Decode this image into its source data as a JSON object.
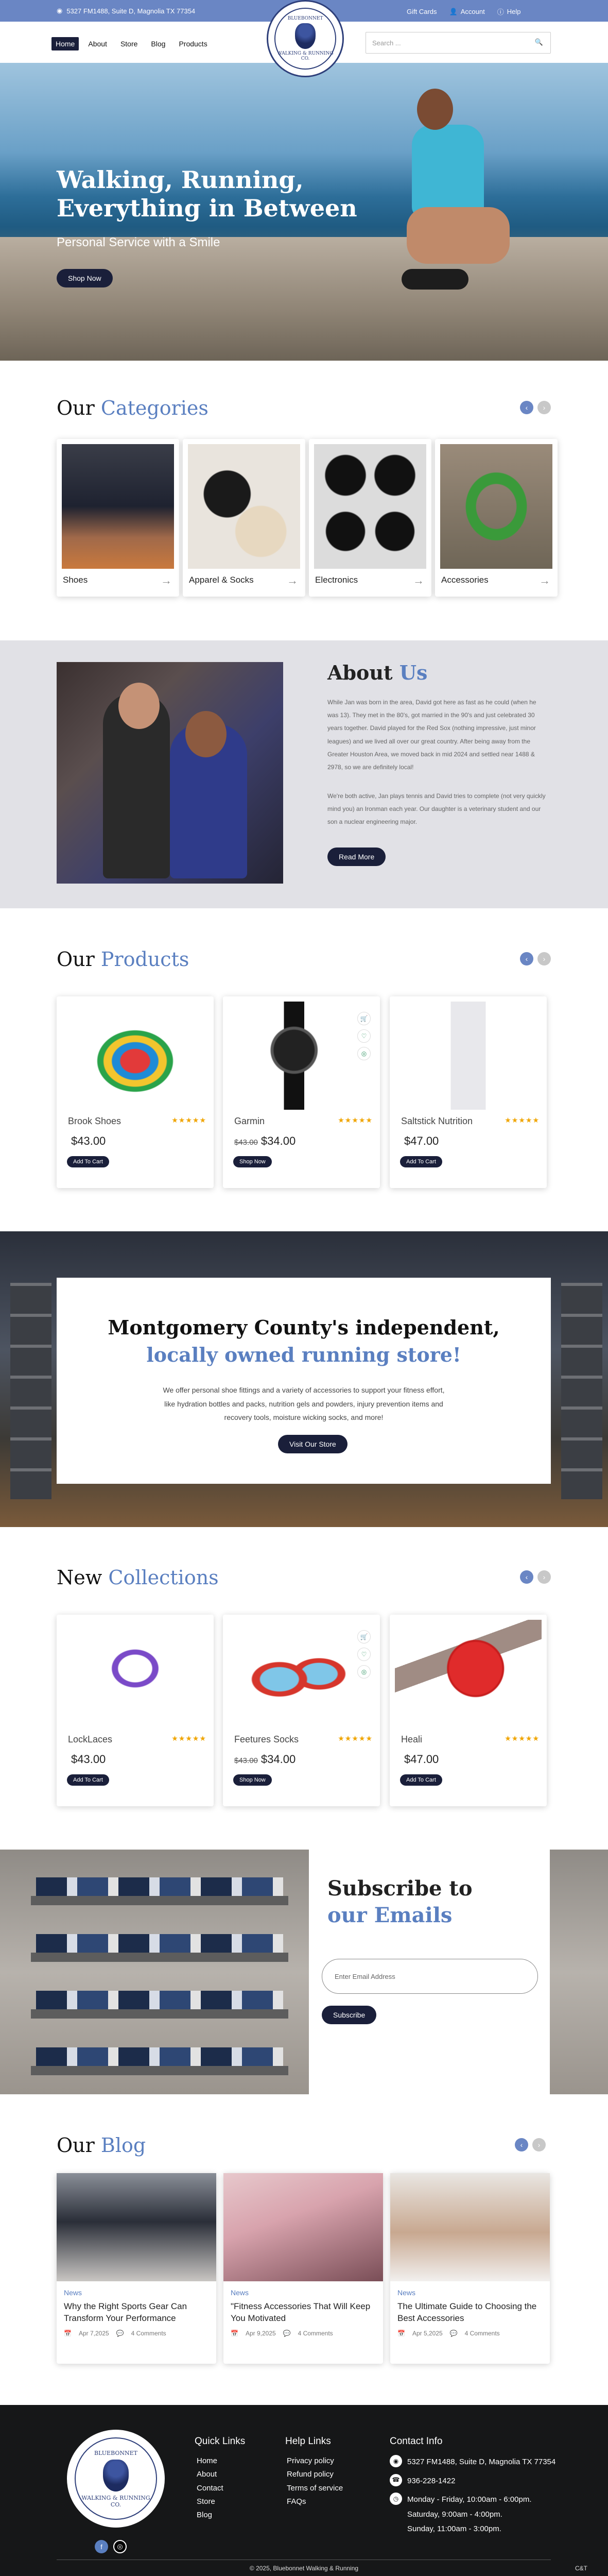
{
  "topbar": {
    "address": "5327 FM1488, Suite D, Magnolia TX 77354",
    "gift_cards": "Gift Cards",
    "account": "Account",
    "help": "Help"
  },
  "nav": {
    "items": [
      "Home",
      "About",
      "Store",
      "Blog",
      "Products"
    ],
    "active": "Home",
    "search_placeholder": "Search ..."
  },
  "logo": {
    "line1": "BLUEBONNET",
    "line2": "WALKING & RUNNING CO."
  },
  "hero": {
    "title_line1": "Walking, Running,",
    "title_line2": "Everything in Between",
    "subtitle": "Personal Service with a Smile",
    "cta": "Shop Now"
  },
  "categories": {
    "heading_plain": "Our",
    "heading_accent": "Categories",
    "items": [
      {
        "label": "Shoes"
      },
      {
        "label": "Apparel & Socks"
      },
      {
        "label": "Electronics"
      },
      {
        "label": "Accessories"
      }
    ]
  },
  "about": {
    "heading_plain": "About",
    "heading_accent": "Us",
    "para1": "While Jan was born in the area, David got here as fast as he could (when he was 13). They met in the 80's, got married in the 90's and just celebrated 30 years together. David played for the Red Sox (nothing impressive, just minor leagues) and we lived all over our great country. After being away from the Greater Houston Area, we moved back in mid 2024 and settled near 1488 & 2978, so we are definitely local!",
    "para2": "We're both active, Jan plays tennis and David tries to complete (not very quickly mind you) an Ironman each year. Our daughter is a veterinary student and our son a nuclear engineering major.",
    "cta": "Read More"
  },
  "products": {
    "heading_plain": "Our",
    "heading_accent": "Products",
    "items": [
      {
        "name": "Brook Shoes",
        "old_price": "",
        "price": "$43.00",
        "button": "Add To Cart",
        "stars": "★★★★★"
      },
      {
        "name": "Garmin",
        "old_price": "$43.00",
        "price": "$34.00",
        "button": "Shop Now",
        "stars": "★★★★★"
      },
      {
        "name": "Saltstick Nutrition",
        "old_price": "",
        "price": "$47.00",
        "button": "Add To Cart",
        "stars": "★★★★★"
      }
    ]
  },
  "store_banner": {
    "title_line1": "Montgomery County's independent,",
    "title_line2": "locally owned running store!",
    "text": "We offer personal shoe fittings and a variety of accessories to support your fitness effort, like hydration bottles and packs, nutrition gels and powders, injury prevention items and recovery tools, moisture wicking socks, and more!",
    "cta": "Visit Our Store"
  },
  "collections": {
    "heading_plain": "New",
    "heading_accent": "Collections",
    "items": [
      {
        "name": "LockLaces",
        "old_price": "",
        "price": "$43.00",
        "button": "Add To Cart",
        "stars": "★★★★★"
      },
      {
        "name": "Feetures Socks",
        "old_price": "$43.00",
        "price": "$34.00",
        "button": "Shop Now",
        "stars": "★★★★★"
      },
      {
        "name": "Heali",
        "old_price": "",
        "price": "$47.00",
        "button": "Add To Cart",
        "stars": "★★★★★"
      }
    ]
  },
  "subscribe": {
    "title_line1": "Subscribe to",
    "title_line2": "our Emails",
    "placeholder": "Enter Email Address",
    "cta": "Subscribe"
  },
  "blog": {
    "heading_plain": "Our",
    "heading_accent": "Blog",
    "posts": [
      {
        "category": "News",
        "title": "Why the Right Sports Gear Can Transform Your Performance",
        "date": "Apr 7,2025",
        "comments": "4 Comments"
      },
      {
        "category": "News",
        "title": "\"Fitness Accessories That Will Keep You Motivated",
        "date": "Apr 9,2025",
        "comments": "4 Comments"
      },
      {
        "category": "News",
        "title": "The Ultimate Guide to Choosing the Best Accessories",
        "date": "Apr 5,2025",
        "comments": "4 Comments"
      }
    ]
  },
  "footer": {
    "quick_links_title": "Quick Links",
    "quick_links": [
      "Home",
      "About",
      "Contact",
      "Store",
      "Blog"
    ],
    "help_links_title": "Help Links",
    "help_links": [
      "Privacy policy",
      "Refund policy",
      "Terms of service",
      "FAQs"
    ],
    "contact_title": "Contact Info",
    "address": "5327 FM1488, Suite D, Magnolia TX 77354",
    "phone": "936-228-1422",
    "hours1": "Monday - Friday, 10:00am - 6:00pm.",
    "hours2": "Saturday, 9:00am - 4:00pm.",
    "hours3": "Sunday, 11:00am - 3:00pm.",
    "copyright": "© 2025, Bluebonnet Walking & Running",
    "corner": "C&T"
  },
  "colors": {
    "accent": "#5a7fc0",
    "topbar": "#6a86c4",
    "dark_button": "#1a1f3a",
    "footer": "#161718",
    "stars": "#f0a500"
  }
}
